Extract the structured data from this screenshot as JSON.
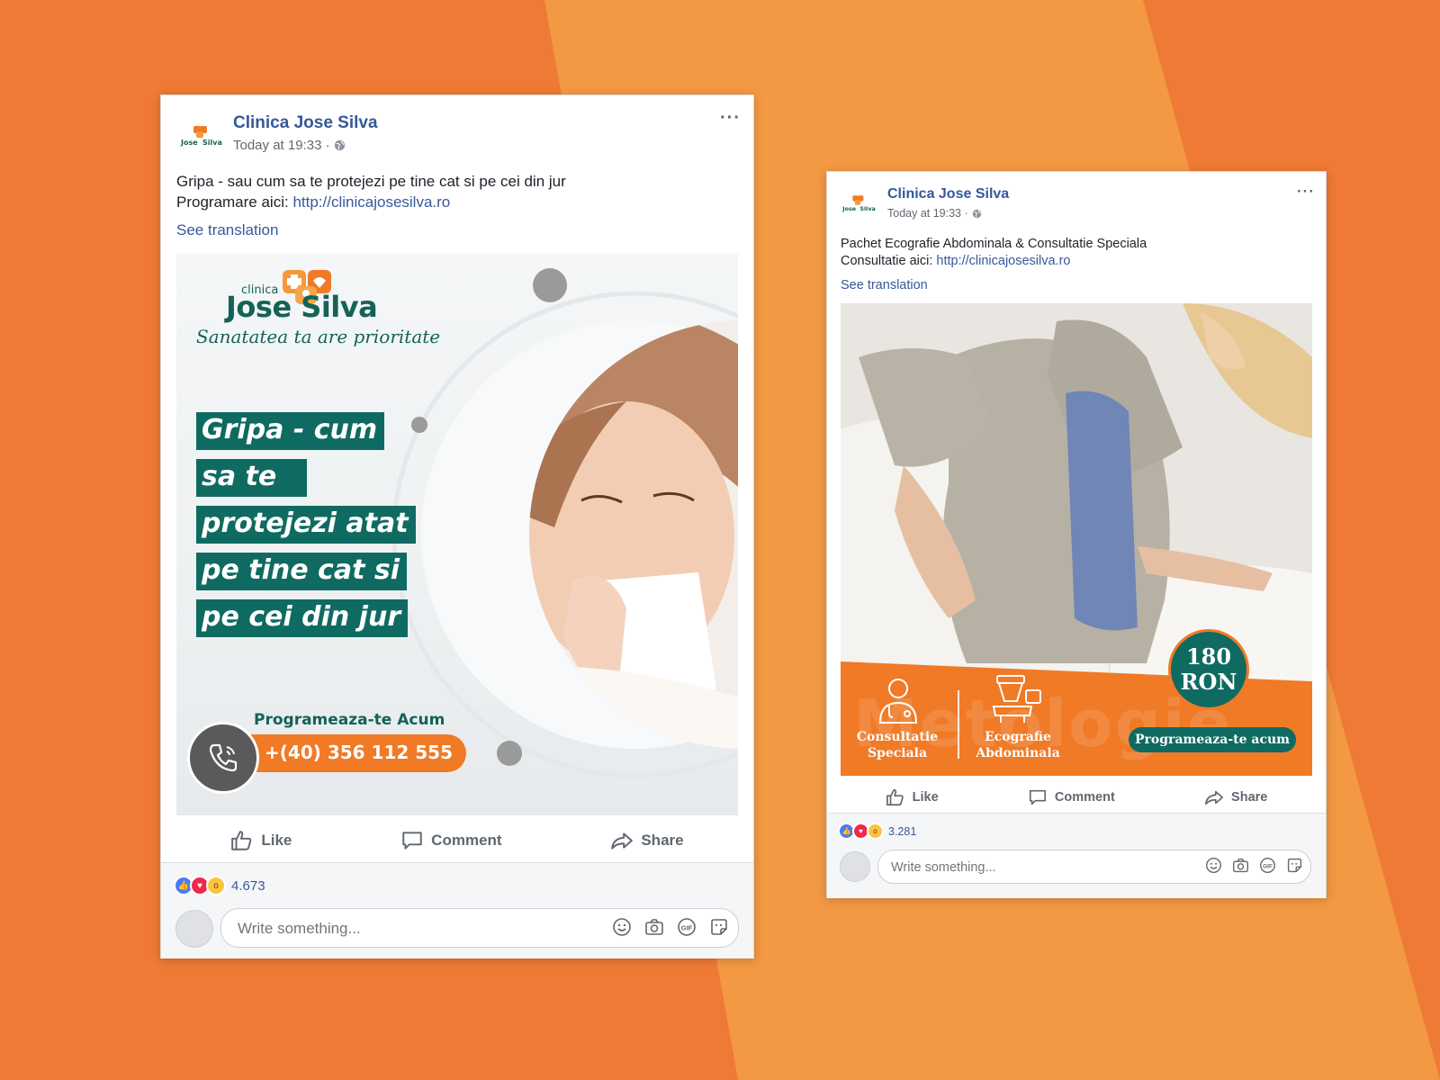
{
  "colors": {
    "background": "#ee7a35",
    "background_band": "#f39843",
    "fb_blue": "#365899",
    "clinic_teal": "#0f6b61",
    "clinic_orange": "#f07a26",
    "like_blue": "#4b7bf5",
    "love_red": "#f0284a",
    "wow_yellow": "#fcc43c"
  },
  "posts": [
    {
      "page_name": "Clinica Jose Silva",
      "timestamp": "Today at 19:33 ·",
      "logo_text": "Jose Silva",
      "privacy_icon": "globe-icon",
      "more_label": "···",
      "text_line1": "Gripa - sau cum sa te protejezi pe tine cat si pe cei din jur",
      "text_line2_prefix": "Programare aici:",
      "link": "http://clinicajosesilva.ro",
      "see_translation": "See translation",
      "creative": {
        "brand_clinica": "clinica",
        "brand_name": "Jose Silva",
        "tagline": "Sanatatea ta are prioritate",
        "headline_lines": [
          "Gripa - cum",
          "sa te",
          "protejezi atat",
          "pe tine cat si",
          "pe cei din jur"
        ],
        "cta_label": "Programeaza-te Acum",
        "phone": "+(40) 356 112 555",
        "phone_icon": "phone-icon"
      },
      "actions": {
        "like": "Like",
        "comment": "Comment",
        "share": "Share"
      },
      "reaction_icons": [
        "like-reaction-icon",
        "love-reaction-icon",
        "wow-reaction-icon"
      ],
      "reaction_count": "4.673",
      "comment_placeholder": "Write something...",
      "comment_icons": [
        "smiley-icon",
        "camera-icon",
        "gif-icon",
        "sticker-icon"
      ]
    },
    {
      "page_name": "Clinica Jose Silva",
      "timestamp": "Today at 19:33 ·",
      "logo_text": "Jose Silva",
      "privacy_icon": "globe-icon",
      "more_label": "···",
      "text_line1": "Pachet Ecografie Abdominala & Consultatie Speciala",
      "text_line2_prefix": "Consultatie aici:",
      "link": "http://clinicajosesilva.ro",
      "see_translation": "See translation",
      "creative": {
        "price_amount": "180",
        "price_currency": "RON",
        "service1_line1": "Consultatie",
        "service1_line2": "Speciala",
        "service1_icon": "doctor-icon",
        "service2_line1": "Ecografie",
        "service2_line2": "Abdominala",
        "service2_icon": "ultrasound-icon",
        "cta_label": "Programeaza-te acum",
        "watermark": "Metologie"
      },
      "actions": {
        "like": "Like",
        "comment": "Comment",
        "share": "Share"
      },
      "reaction_icons": [
        "like-reaction-icon",
        "love-reaction-icon",
        "wow-reaction-icon"
      ],
      "reaction_count": "3.281",
      "comment_placeholder": "Write something...",
      "comment_icons": [
        "smiley-icon",
        "camera-icon",
        "gif-icon",
        "sticker-icon"
      ]
    }
  ]
}
